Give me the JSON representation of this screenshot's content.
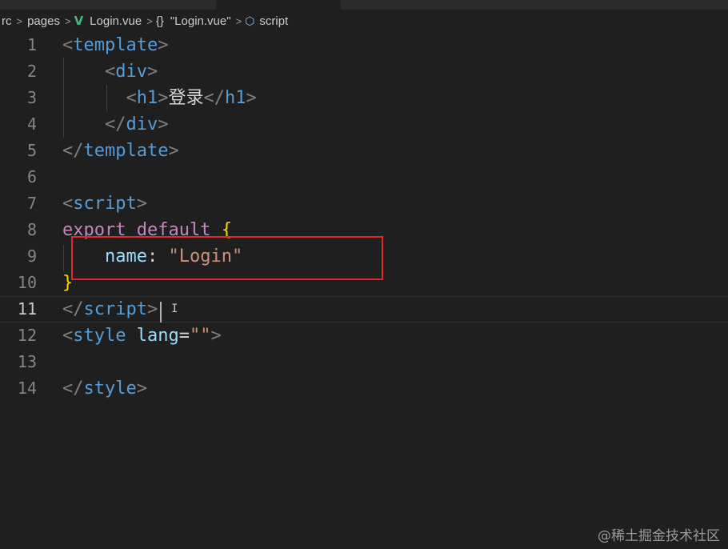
{
  "breadcrumb": {
    "items": [
      "rc",
      "pages",
      "Login.vue",
      "\"Login.vue\"",
      "script"
    ],
    "separator": ">",
    "braces": "{}"
  },
  "editor": {
    "current_line": 11,
    "lines": [
      {
        "n": "1",
        "tokens": [
          [
            "t-punct",
            "<"
          ],
          [
            "t-tag",
            "template"
          ],
          [
            "t-punct",
            ">"
          ]
        ]
      },
      {
        "n": "2",
        "tokens": [
          [
            "t-punct",
            "    <"
          ],
          [
            "t-tag",
            "div"
          ],
          [
            "t-punct",
            ">"
          ]
        ]
      },
      {
        "n": "3",
        "tokens": [
          [
            "t-punct",
            "      <"
          ],
          [
            "t-tag",
            "h1"
          ],
          [
            "t-punct",
            ">"
          ],
          [
            "t-text",
            "登录"
          ],
          [
            "t-punct",
            "</"
          ],
          [
            "t-tag",
            "h1"
          ],
          [
            "t-punct",
            ">"
          ]
        ]
      },
      {
        "n": "4",
        "tokens": [
          [
            "t-punct",
            "    </"
          ],
          [
            "t-tag",
            "div"
          ],
          [
            "t-punct",
            ">"
          ]
        ]
      },
      {
        "n": "5",
        "tokens": [
          [
            "t-punct",
            "</"
          ],
          [
            "t-tag",
            "template"
          ],
          [
            "t-punct",
            ">"
          ]
        ]
      },
      {
        "n": "6",
        "tokens": []
      },
      {
        "n": "7",
        "tokens": [
          [
            "t-punct",
            "<"
          ],
          [
            "t-tag",
            "script"
          ],
          [
            "t-punct",
            ">"
          ]
        ]
      },
      {
        "n": "8",
        "tokens": [
          [
            "t-kw",
            "export"
          ],
          [
            "t-eq",
            " "
          ],
          [
            "t-kw",
            "default"
          ],
          [
            "t-eq",
            " "
          ],
          [
            "t-brace",
            "{"
          ]
        ]
      },
      {
        "n": "9",
        "tokens": [
          [
            "t-eq",
            "    "
          ],
          [
            "t-prop",
            "name"
          ],
          [
            "t-eq",
            ": "
          ],
          [
            "t-str",
            "\"Login\""
          ]
        ]
      },
      {
        "n": "10",
        "tokens": [
          [
            "t-brace",
            "}"
          ]
        ]
      },
      {
        "n": "11",
        "tokens": [
          [
            "t-punct",
            "</"
          ],
          [
            "t-tag",
            "script"
          ],
          [
            "t-punct",
            ">"
          ]
        ]
      },
      {
        "n": "12",
        "tokens": [
          [
            "t-punct",
            "<"
          ],
          [
            "t-tag",
            "style"
          ],
          [
            "t-eq",
            " "
          ],
          [
            "t-attr",
            "lang"
          ],
          [
            "t-eq",
            "="
          ],
          [
            "t-str",
            "\"\""
          ],
          [
            "t-punct",
            ">"
          ]
        ]
      },
      {
        "n": "13",
        "tokens": []
      },
      {
        "n": "14",
        "tokens": [
          [
            "t-punct",
            "</"
          ],
          [
            "t-tag",
            "style"
          ],
          [
            "t-punct",
            ">"
          ]
        ]
      }
    ]
  },
  "watermark": "@稀土掘金技术社区",
  "colors": {
    "background": "#1f1f1f",
    "tag": "#569cd6",
    "keyword": "#c586c0",
    "string": "#ce9178",
    "property": "#9cdcfe",
    "brace": "#ffd700",
    "highlight_box": "#e0282d"
  }
}
